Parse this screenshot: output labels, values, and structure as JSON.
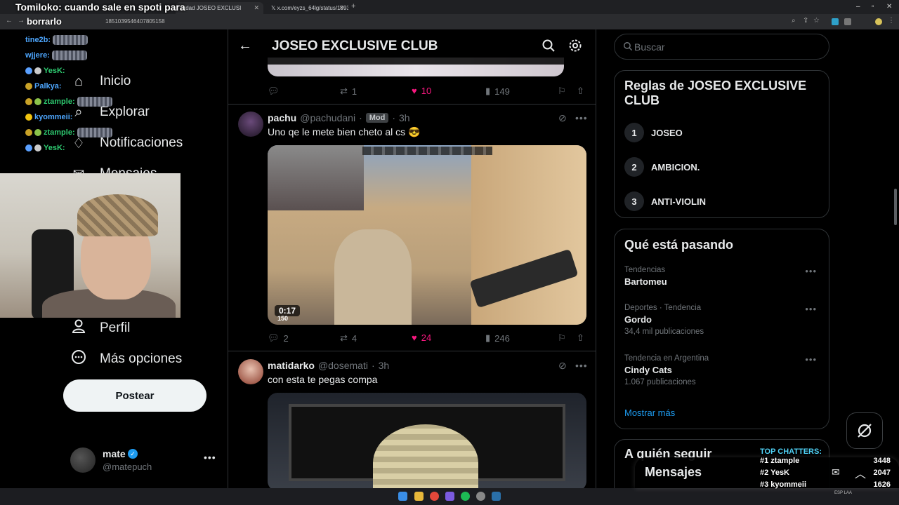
{
  "stream_overlay": {
    "title": "Tomiloko: cuando sale en spoti para",
    "url_overlay": "borrarlo"
  },
  "browser": {
    "tabs": [
      {
        "label": "nidad JOSEO EXCLUSI",
        "active": true
      },
      {
        "label": "x.com/eyzs_64lg/status/19934",
        "active": false
      }
    ],
    "url": "1851039546407805158"
  },
  "chat": {
    "lines": [
      {
        "user": "tine2b:",
        "color": "#4ea7ff"
      },
      {
        "user": "wjjere:",
        "color": "#4ea7ff"
      },
      {
        "user": "YesK:",
        "color": "#2ecc71"
      },
      {
        "user": "Palkya:",
        "color": "#4ea7ff"
      },
      {
        "user": "ztample:",
        "color": "#2ecc71"
      },
      {
        "user": "kyommeii:",
        "color": "#4ea7ff"
      },
      {
        "user": "ztample:",
        "color": "#2ecc71"
      },
      {
        "user": "YesK:",
        "color": "#2ecc71"
      }
    ]
  },
  "nav": {
    "items": [
      {
        "label": "Inicio",
        "icon": "home-icon"
      },
      {
        "label": "Explorar",
        "icon": "search-icon"
      },
      {
        "label": "Notificaciones",
        "icon": "bell-icon"
      },
      {
        "label": "Mensajes",
        "icon": "mail-icon"
      },
      {
        "label": "Perfil",
        "icon": "person-icon"
      },
      {
        "label": "Más opciones",
        "icon": "more-circle-icon"
      }
    ],
    "post_label": "Postear",
    "account": {
      "name": "mate",
      "handle": "@matepuch"
    }
  },
  "header": {
    "title": "JOSEO EXCLUSIVE CLUB"
  },
  "feed": {
    "prev_actions": {
      "replies": "",
      "reposts": "1",
      "likes": "10",
      "views": "149"
    },
    "tweets": [
      {
        "name": "pachu",
        "handle": "@pachudani",
        "badge": "Mod",
        "time": "3h",
        "text": "Uno qe le mete bien cheto al cs 😎",
        "media_duration": "0:17",
        "media_hud": "150",
        "actions": {
          "replies": "2",
          "reposts": "4",
          "likes": "24",
          "views": "246"
        }
      },
      {
        "name": "matidarko",
        "handle": "@dosemati",
        "time": "3h",
        "text": "con esta te pegas compa"
      }
    ]
  },
  "search": {
    "placeholder": "Buscar"
  },
  "rules": {
    "title": "Reglas de JOSEO EXCLUSIVE CLUB",
    "items": [
      {
        "num": "1",
        "label": "JOSEO"
      },
      {
        "num": "2",
        "label": "AMBICION."
      },
      {
        "num": "3",
        "label": "ANTI-VIOLIN"
      }
    ]
  },
  "trends": {
    "title": "Qué está pasando",
    "items": [
      {
        "context": "Tendencias",
        "name": "Bartomeu",
        "count": ""
      },
      {
        "context": "Deportes · Tendencia",
        "name": "Gordo",
        "count": "34,4 mil publicaciones"
      },
      {
        "context": "Tendencia en Argentina",
        "name": "Cindy Cats",
        "count": "1.067 publicaciones"
      }
    ],
    "show_more": "Mostrar más"
  },
  "who_to_follow": {
    "title": "A quién seguir"
  },
  "messages": {
    "title": "Mensajes"
  },
  "top_chatters": {
    "title": "TOP CHATTERS:",
    "rows": [
      {
        "rank": "#1 ztample",
        "count": "3448"
      },
      {
        "rank": "#2 YesK",
        "count": "2047"
      },
      {
        "rank": "#3 kyommeii",
        "count": "1626"
      }
    ]
  },
  "taskbar": {
    "lang": "ESP\nLAA"
  },
  "colors": {
    "like": "#f91880",
    "link": "#1d9bf0",
    "verified": "#1d9bf0",
    "chatter_title": "#4fd1f5"
  }
}
